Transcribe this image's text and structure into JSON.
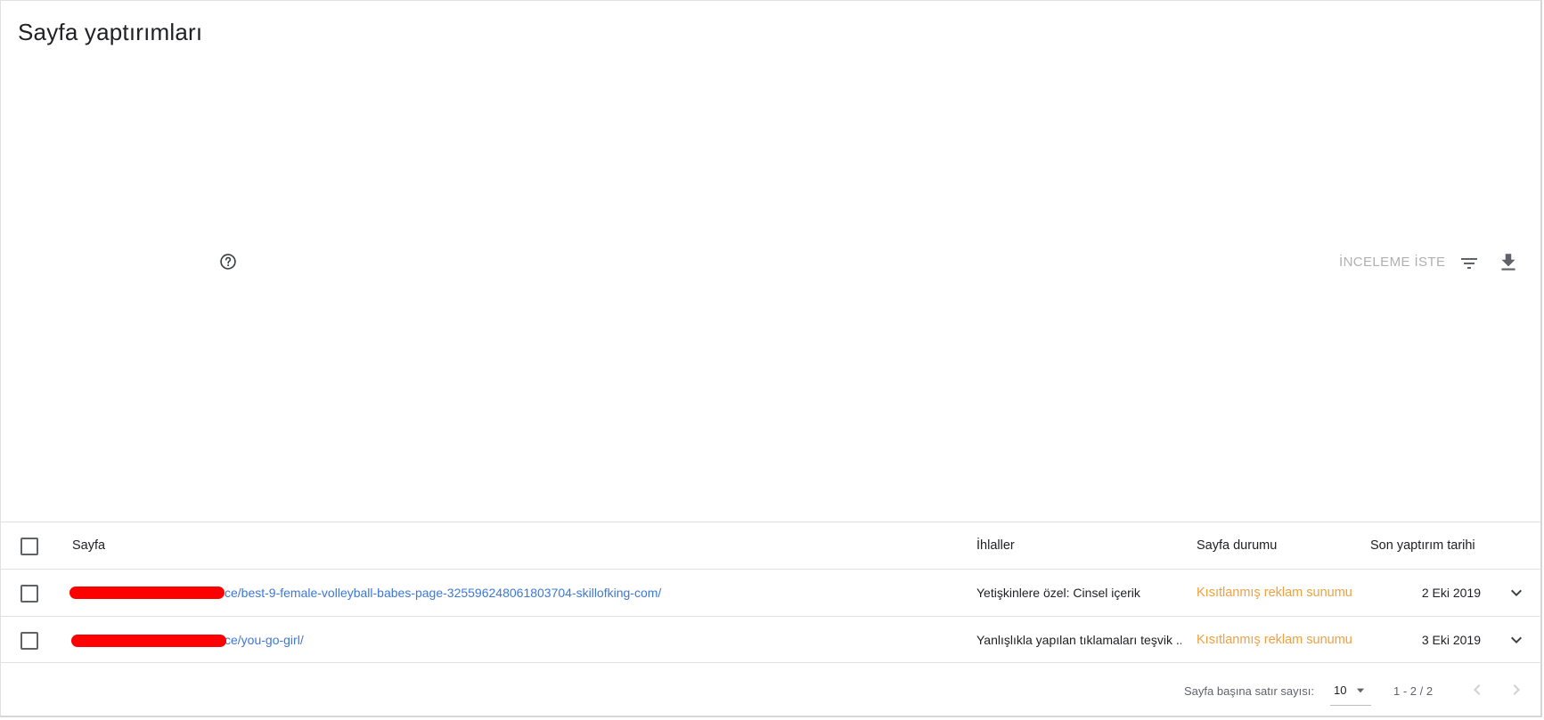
{
  "page": {
    "title": "Sayfa yaptırımları"
  },
  "toolbar": {
    "request_review_label": "İNCELEME İSTE",
    "help_icon": "help-circle-icon",
    "filter_icon": "filter-icon",
    "download_icon": "download-icon"
  },
  "table": {
    "headers": {
      "page": "Sayfa",
      "violations": "İhlaller",
      "page_status": "Sayfa durumu",
      "last_enforcement_date": "Son yaptırım tarihi"
    },
    "rows": [
      {
        "page_url": "ce/best-9-female-volleyball-babes-page-325596248061803704-skillofking-com/",
        "violation": "Yetişkinlere özel: Cinsel içerik",
        "status": "Kısıtlanmış reklam sunumu",
        "date": "2 Eki 2019"
      },
      {
        "page_url": "ce/you-go-girl/",
        "violation": "Yanlışlıkla yapılan tıklamaları teşvik ...",
        "status": "Kısıtlanmış reklam sunumu",
        "date": "3 Eki 2019"
      }
    ]
  },
  "footer": {
    "rows_per_page_label": "Sayfa başına satır sayısı:",
    "rows_per_page_value": "10",
    "range_label": "1 - 2 / 2"
  },
  "colors": {
    "link": "#3c78d8",
    "status_warning": "#f0a03c",
    "redaction": "#ff0000",
    "disabled_text": "#b0b0b0"
  }
}
